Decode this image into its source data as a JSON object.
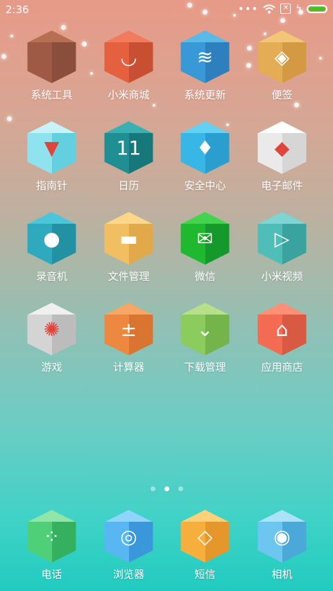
{
  "status_bar": {
    "time": "2:36",
    "more_glyph": "•••",
    "bolt_glyph": "ϟ",
    "battery_level": 1.0
  },
  "pages": {
    "count": 3,
    "active": 1
  },
  "apps": [
    {
      "label": "系统工具",
      "icon": "folder-icon",
      "colors": [
        "#b86e53",
        "#9e5a45",
        "#8a4e3c"
      ],
      "glyph": ""
    },
    {
      "label": "小米商城",
      "icon": "mi-store-icon",
      "colors": [
        "#f27a5d",
        "#e5603f",
        "#c94f33"
      ],
      "glyph": "◡"
    },
    {
      "label": "系统更新",
      "icon": "update-icon",
      "colors": [
        "#5bb9e8",
        "#3998d6",
        "#2d7fbd"
      ],
      "glyph": "≋"
    },
    {
      "label": "便签",
      "icon": "notes-icon",
      "colors": [
        "#f1c676",
        "#e4ad55",
        "#d39a43"
      ],
      "glyph": "◈"
    },
    {
      "label": "指南针",
      "icon": "compass-icon",
      "colors": [
        "#c7f2f7",
        "#8fe3ef",
        "#63cfdf"
      ],
      "glyph": "▼"
    },
    {
      "label": "日历",
      "icon": "calendar-icon",
      "colors": [
        "#3ab0b3",
        "#1f8f93",
        "#17787c"
      ],
      "glyph": "11"
    },
    {
      "label": "安全中心",
      "icon": "security-icon",
      "colors": [
        "#64d1f2",
        "#38b7e6",
        "#2a9fcf"
      ],
      "glyph": "♦"
    },
    {
      "label": "电子邮件",
      "icon": "email-icon",
      "colors": [
        "#ffffff",
        "#eaeaea",
        "#d6d6d6"
      ],
      "glyph": "◆"
    },
    {
      "label": "录音机",
      "icon": "recorder-icon",
      "colors": [
        "#4ac6d8",
        "#2ea9bd",
        "#2391a4"
      ],
      "glyph": "●"
    },
    {
      "label": "文件管理",
      "icon": "file-manager-icon",
      "colors": [
        "#fcd789",
        "#f1be62",
        "#e2a94b"
      ],
      "glyph": "▬"
    },
    {
      "label": "微信",
      "icon": "wechat-icon",
      "colors": [
        "#44d34f",
        "#20b82f",
        "#15992a"
      ],
      "glyph": "✉"
    },
    {
      "label": "小米视频",
      "icon": "video-icon",
      "colors": [
        "#7dd6d2",
        "#4fbdb8",
        "#3aa39f"
      ],
      "glyph": "▷"
    },
    {
      "label": "游戏",
      "icon": "game-icon",
      "colors": [
        "#f0f0f0",
        "#d4d4d4",
        "#bcbcbc"
      ],
      "glyph": "✺"
    },
    {
      "label": "计算器",
      "icon": "calculator-icon",
      "colors": [
        "#f6a766",
        "#ed8840",
        "#d97530"
      ],
      "glyph": "±"
    },
    {
      "label": "下载管理",
      "icon": "download-icon",
      "colors": [
        "#b8e08a",
        "#8ccc5f",
        "#74b44a"
      ],
      "glyph": "⌄"
    },
    {
      "label": "应用商店",
      "icon": "app-store-icon",
      "colors": [
        "#ff8f75",
        "#f26b52",
        "#d85a43"
      ],
      "glyph": "⌂"
    }
  ],
  "dock": [
    {
      "label": "电话",
      "icon": "phone-icon",
      "colors": [
        "#8fe6a8",
        "#4fcf78",
        "#35b05f"
      ],
      "glyph": "⁘"
    },
    {
      "label": "浏览器",
      "icon": "browser-icon",
      "colors": [
        "#8fd4fb",
        "#58b6f2",
        "#3a98da"
      ],
      "glyph": "◎"
    },
    {
      "label": "短信",
      "icon": "sms-icon",
      "colors": [
        "#ffd27a",
        "#f6ae3c",
        "#e5972b"
      ],
      "glyph": "◇"
    },
    {
      "label": "相机",
      "icon": "camera-icon",
      "colors": [
        "#a9e2f9",
        "#6cc6ef",
        "#4aa9d8"
      ],
      "glyph": "◉"
    }
  ]
}
